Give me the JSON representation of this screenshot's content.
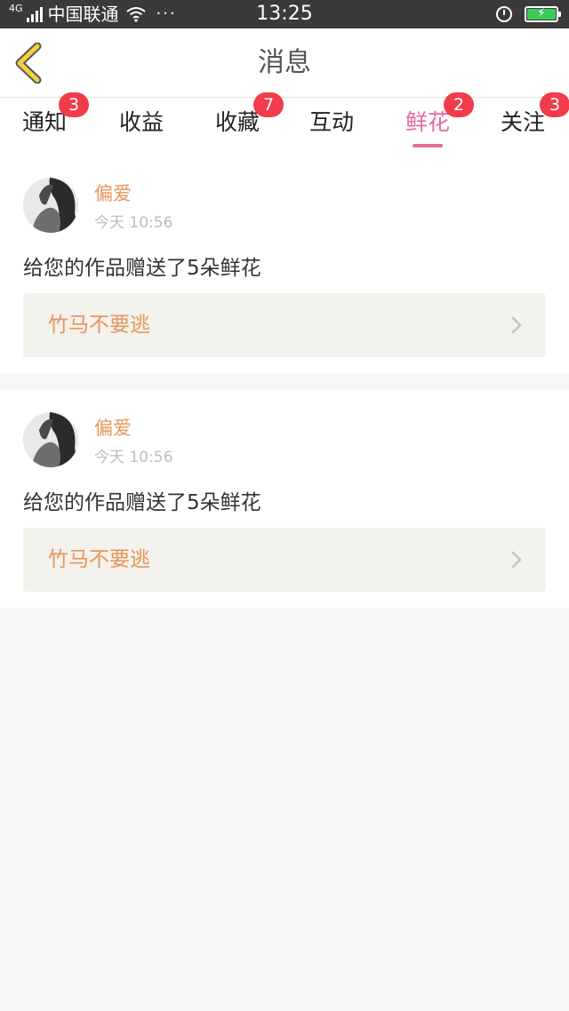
{
  "status_bar": {
    "network": "4G",
    "carrier": "中国联通",
    "more": "···",
    "time": "13:25",
    "battery_level": 1.0
  },
  "header": {
    "title": "消息"
  },
  "tabs": [
    {
      "label": "通知",
      "badge": "3",
      "active": false
    },
    {
      "label": "收益",
      "badge": "",
      "active": false
    },
    {
      "label": "收藏",
      "badge": "7",
      "active": false
    },
    {
      "label": "互动",
      "badge": "",
      "active": false
    },
    {
      "label": "鲜花",
      "badge": "2",
      "active": true
    },
    {
      "label": "关注",
      "badge": "3",
      "active": false
    }
  ],
  "messages": [
    {
      "user": "偏爱",
      "time": "今天 10:56",
      "text": "给您的作品赠送了5朵鲜花",
      "work_title": "竹马不要逃"
    },
    {
      "user": "偏爱",
      "time": "今天 10:56",
      "text": "给您的作品赠送了5朵鲜花",
      "work_title": "竹马不要逃"
    }
  ],
  "colors": {
    "accent_pink": "#e46a9c",
    "accent_orange": "#e8945a",
    "badge_red": "#f13d4a",
    "back_arrow": "#f4d23c"
  }
}
